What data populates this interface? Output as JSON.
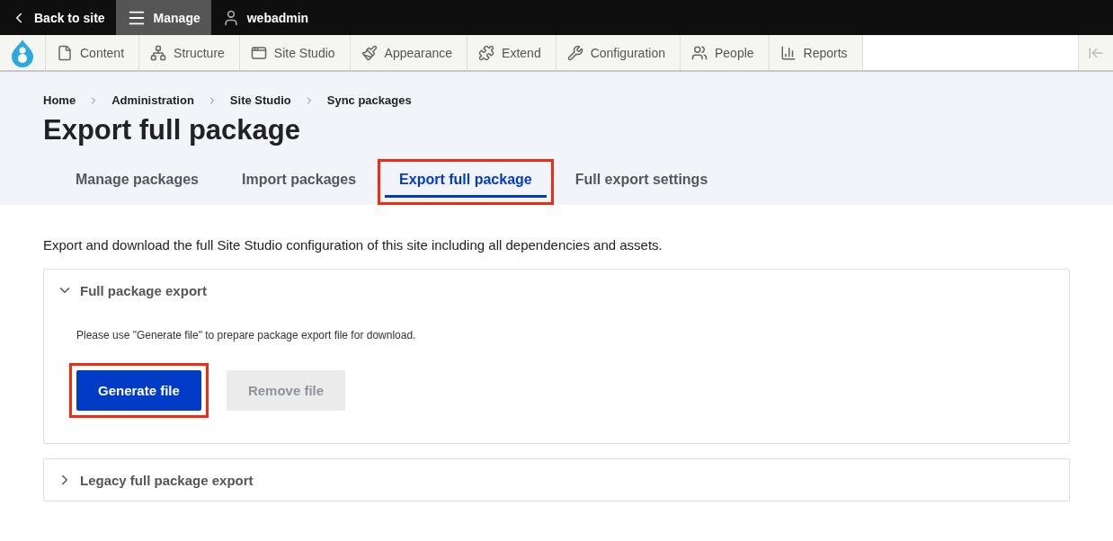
{
  "toolbar": {
    "back": "Back to site",
    "manage": {
      "label": "Manage",
      "selected": true
    },
    "user": "webadmin"
  },
  "menu": [
    {
      "label": "Content"
    },
    {
      "label": "Structure"
    },
    {
      "label": "Site Studio"
    },
    {
      "label": "Appearance"
    },
    {
      "label": "Extend"
    },
    {
      "label": "Configuration"
    },
    {
      "label": "People"
    },
    {
      "label": "Reports"
    }
  ],
  "breadcrumb": [
    "Home",
    "Administration",
    "Site Studio",
    "Sync packages"
  ],
  "title": "Export full package",
  "tabs": [
    {
      "label": "Manage packages",
      "selected": false,
      "highlighted": false
    },
    {
      "label": "Import packages",
      "selected": false,
      "highlighted": false
    },
    {
      "label": "Export full package",
      "selected": true,
      "highlighted": true
    },
    {
      "label": "Full export settings",
      "selected": false,
      "highlighted": false
    }
  ],
  "description": "Export and download the full Site Studio configuration of this site including all dependencies and assets.",
  "sections": [
    {
      "title": "Full package export",
      "expanded": true,
      "help": "Please use \"Generate file\" to prepare package export file for download.",
      "buttons": [
        {
          "label": "Generate file",
          "disabled": false,
          "highlighted": true
        },
        {
          "label": "Remove file",
          "disabled": true,
          "highlighted": false
        }
      ]
    },
    {
      "title": "Legacy full package export",
      "expanded": false
    }
  ]
}
